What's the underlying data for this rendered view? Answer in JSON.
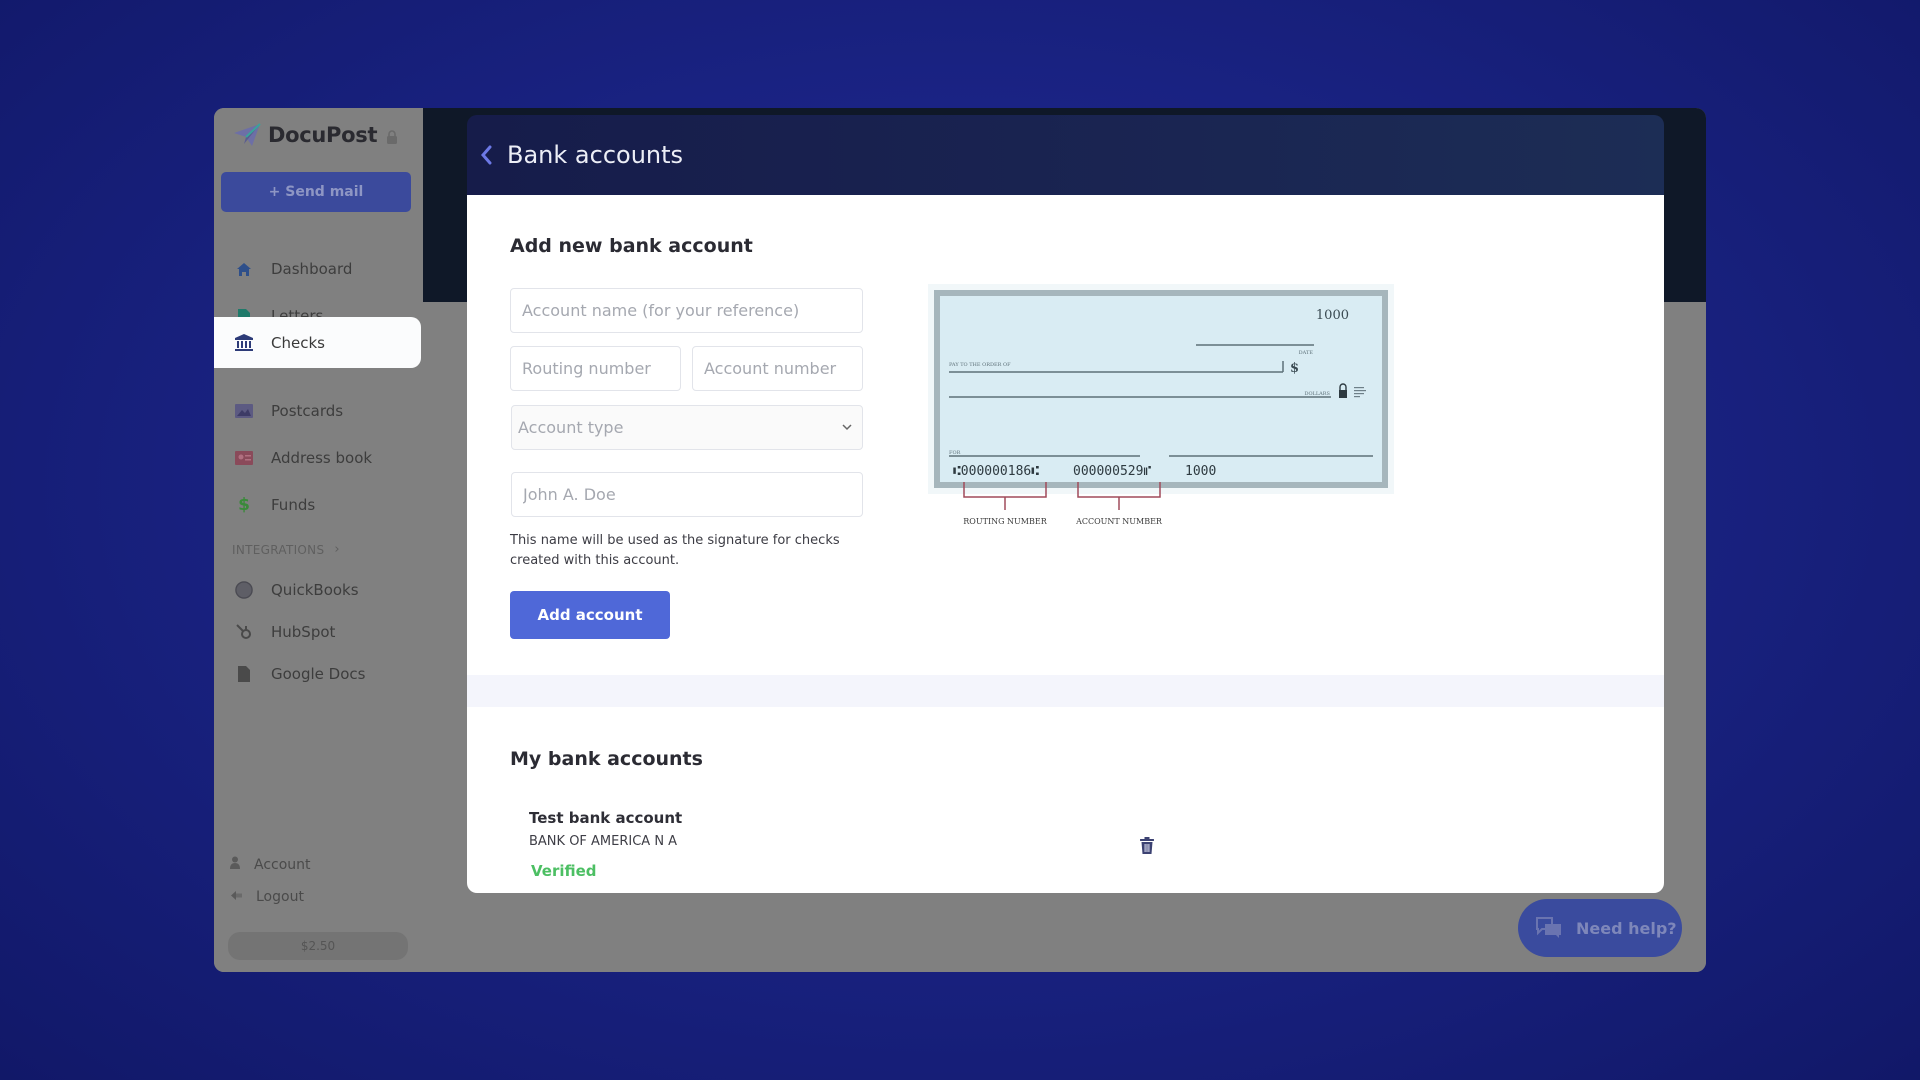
{
  "app": {
    "brand": "DocuPost",
    "send_mail_label": "+ Send mail"
  },
  "sidebar": {
    "items": [
      {
        "label": "Dashboard",
        "icon": "home-icon"
      },
      {
        "label": "Letters",
        "icon": "document-icon"
      },
      {
        "label": "Checks",
        "icon": "bank-icon",
        "active": true
      },
      {
        "label": "Postcards",
        "icon": "image-icon"
      },
      {
        "label": "Address book",
        "icon": "contact-card-icon"
      },
      {
        "label": "Funds",
        "icon": "dollar-icon"
      }
    ],
    "integrations_label": "INTEGRATIONS",
    "integrations": [
      {
        "label": "QuickBooks",
        "icon": "quickbooks-icon"
      },
      {
        "label": "HubSpot",
        "icon": "hubspot-icon"
      },
      {
        "label": "Google Docs",
        "icon": "google-docs-icon"
      }
    ],
    "account_label": "Account",
    "logout_label": "Logout",
    "balance": "$2.50"
  },
  "modal": {
    "title": "Bank accounts",
    "form": {
      "heading": "Add new bank account",
      "account_name_placeholder": "Account name (for your reference)",
      "routing_placeholder": "Routing number",
      "account_number_placeholder": "Account number",
      "account_type_placeholder": "Account type",
      "signature_placeholder": "John A. Doe",
      "hint": "This name will be used as the signature for checks created with this account.",
      "submit_label": "Add account"
    },
    "check_sample": {
      "check_number": "1000",
      "date_label": "DATE",
      "pay_to_label": "PAY TO THE ORDER OF",
      "dollar_sign": "$",
      "dollars_label": "DOLLARS",
      "memo_label": "FOR",
      "micr_routing": "⑆000000186⑆",
      "micr_account": "000000529⑈",
      "micr_check": "1000",
      "routing_caption": "ROUTING NUMBER",
      "account_caption": "ACCOUNT NUMBER"
    },
    "my_accounts": {
      "heading": "My bank accounts",
      "accounts": [
        {
          "name": "Test bank account",
          "bank": "BANK OF AMERICA N A",
          "status": "Verified"
        }
      ]
    }
  },
  "help": {
    "label": "Need help?"
  },
  "colors": {
    "primary": "#4f68d8",
    "verified": "#4cbf63",
    "header_navy": "#161c4a"
  }
}
